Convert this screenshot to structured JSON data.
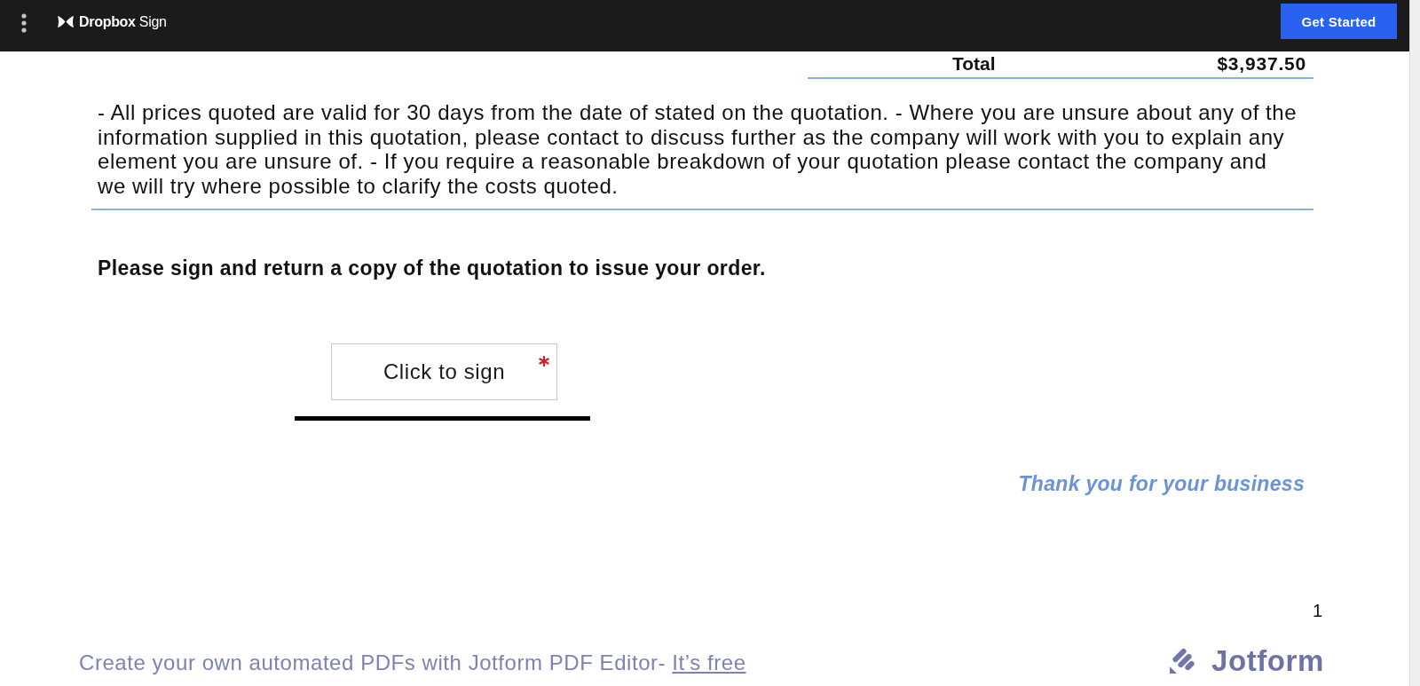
{
  "top_bar": {
    "brand": "**Dropbox** Sign",
    "button": "Get Started"
  },
  "document": {
    "total": {
      "label": "Total",
      "value": "$3,937.50"
    },
    "terms": "- All prices quoted are valid for 30 days from the date of stated on the quotation. - Where you are unsure about any of the information supplied in this quotation, please contact to discuss further as the company will work with you to explain any element you are unsure of. - If you require a reasonable breakdown of your quotation please contact the company and we will try where possible to clarify the costs quoted.",
    "instruction": "Please sign and return a copy of the quotation to issue your order.",
    "signature": {
      "label": "Click to sign",
      "required": true
    },
    "closing": "Thank you for your business",
    "page_number": "1"
  },
  "footer": {
    "promo": "Create your own automated PDFs with Jotform PDF Editor- ",
    "link": "It’s free",
    "logo": "Jotform"
  }
}
